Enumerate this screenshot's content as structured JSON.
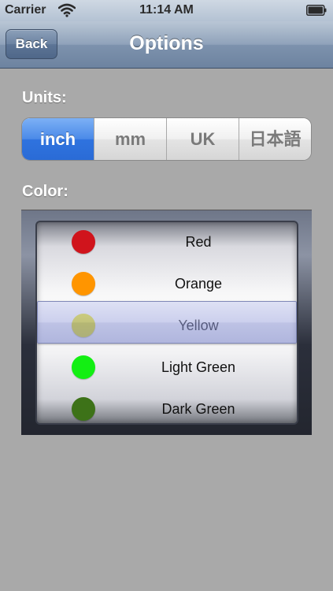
{
  "status_bar": {
    "carrier": "Carrier",
    "time": "11:14 AM",
    "wifi_icon": "wifi-icon",
    "battery_icon": "battery-icon"
  },
  "nav": {
    "back_label": "Back",
    "title": "Options"
  },
  "units": {
    "label": "Units:",
    "options": [
      "inch",
      "mm",
      "UK",
      "日本語"
    ],
    "selected": "inch"
  },
  "color": {
    "label": "Color:",
    "options": [
      {
        "label": "Red",
        "color": "#d0141c"
      },
      {
        "label": "Orange",
        "color": "#ff9500"
      },
      {
        "label": "Yellow",
        "color": "#e6e000"
      },
      {
        "label": "Light Green",
        "color": "#13ef13"
      },
      {
        "label": "Dark Green",
        "color": "#3d7218"
      }
    ],
    "selected": "Yellow"
  },
  "colors": {
    "accent": "#2f73df",
    "nav_bar": "#7d92ad",
    "background": "#a9a9a9"
  }
}
